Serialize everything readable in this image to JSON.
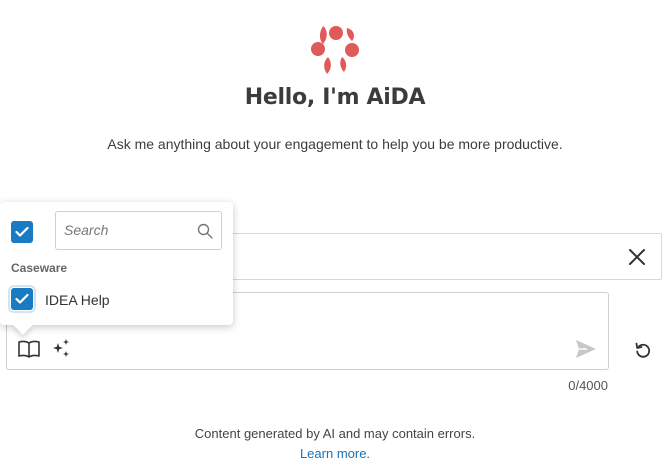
{
  "header": {
    "title": "Hello, I'm AiDA",
    "subtitle": "Ask me anything about your engagement to help you be more productive."
  },
  "colors": {
    "brand": "#e05a5a",
    "accent": "#1b7bc2",
    "link": "#1a73b5"
  },
  "icons": {
    "logo": "aida-logo",
    "close": "close-icon",
    "book": "book-icon",
    "sparkle": "sparkle-icon",
    "send": "send-icon",
    "refresh": "refresh-icon",
    "search": "search-icon",
    "check": "check-icon"
  },
  "source_picker": {
    "search_placeholder": "Search",
    "select_all_checked": true,
    "group_label": "Caseware",
    "items": [
      {
        "label": "IDEA Help",
        "checked": true
      }
    ]
  },
  "composer": {
    "char_count": "0/4000"
  },
  "footer": {
    "disclaimer": "Content generated by AI and may contain errors.",
    "learn_more": "Learn more."
  }
}
